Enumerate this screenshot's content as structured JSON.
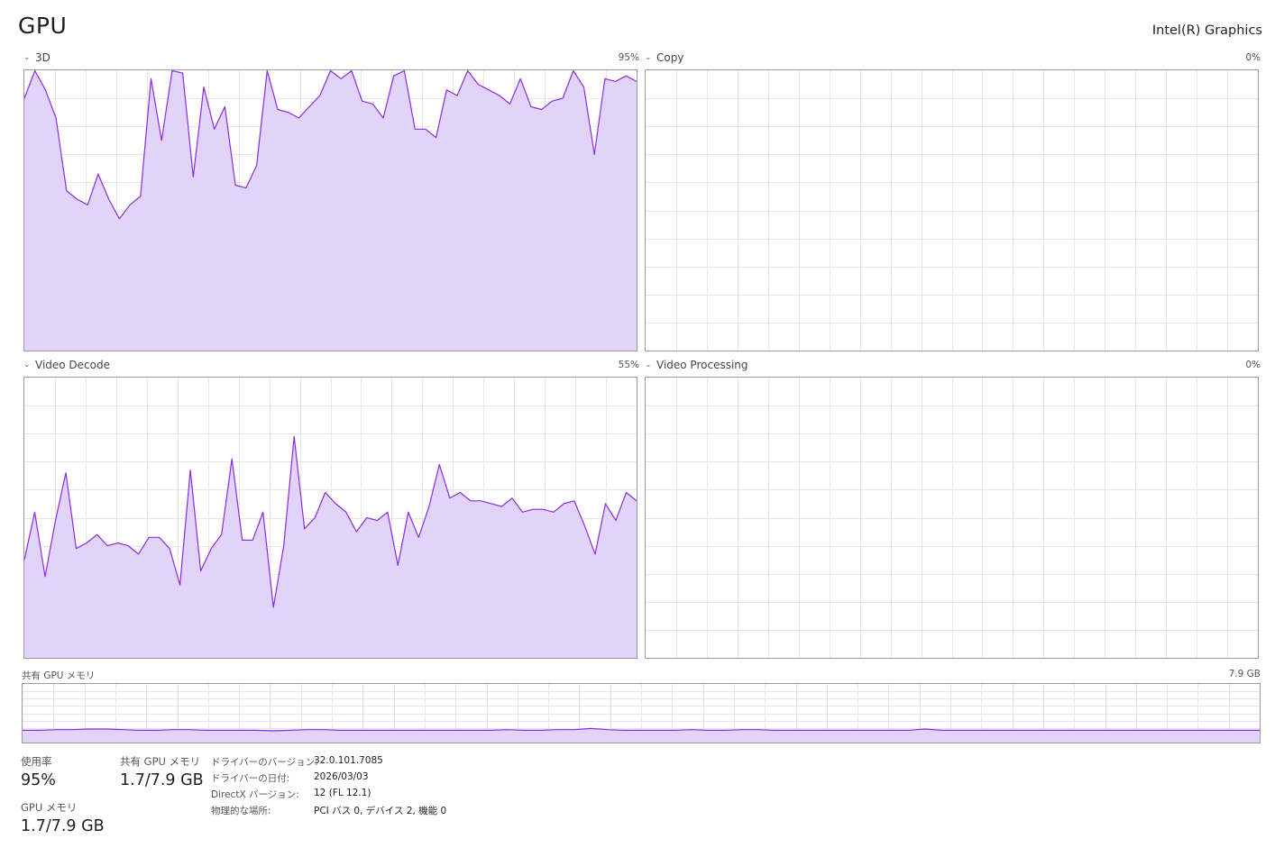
{
  "header": {
    "title": "GPU",
    "gpu_name": "Intel(R) Graphics"
  },
  "engines": [
    {
      "label": "3D",
      "percent": "95%",
      "series": [
        90,
        100,
        93,
        83,
        57,
        54,
        52,
        63,
        54,
        47,
        52,
        55,
        97,
        75,
        100,
        99,
        62,
        94,
        79,
        87,
        59,
        58,
        66,
        100,
        86,
        85,
        83,
        87,
        91,
        100,
        97,
        100,
        89,
        88,
        83,
        98,
        100,
        79,
        79,
        76,
        93,
        91,
        100,
        95,
        93,
        91,
        88,
        97,
        87,
        86,
        89,
        90,
        100,
        94,
        70,
        97,
        96,
        98,
        96
      ],
      "color": "#8a2be2"
    },
    {
      "label": "Copy",
      "percent": "0%",
      "series": [],
      "color": "#8a2be2"
    },
    {
      "label": "Video Decode",
      "percent": "55%",
      "series": [
        35,
        52,
        29,
        49,
        66,
        39,
        41,
        44,
        40,
        41,
        40,
        37,
        43,
        43,
        39,
        26,
        67,
        31,
        39,
        44,
        71,
        42,
        42,
        52,
        18,
        40,
        79,
        46,
        50,
        59,
        55,
        52,
        45,
        50,
        49,
        52,
        33,
        52,
        43,
        54,
        69,
        57,
        59,
        56,
        56,
        55,
        54,
        57,
        52,
        53,
        53,
        52,
        55,
        56,
        47,
        37,
        55,
        49,
        59,
        56
      ],
      "color": "#8a2be2"
    },
    {
      "label": "Video Processing",
      "percent": "0%",
      "series": [],
      "color": "#8a2be2"
    }
  ],
  "shared_memory": {
    "label": "共有 GPU メモリ",
    "max": "7.9 GB",
    "series": [
      21,
      21,
      22,
      22,
      23,
      23,
      22,
      21,
      21,
      22,
      22,
      21,
      21,
      21,
      21,
      20,
      21,
      22,
      22,
      21,
      21,
      21,
      21,
      21,
      21,
      21,
      21,
      21,
      21,
      22,
      21,
      21,
      22,
      22,
      24,
      22,
      21,
      21,
      21,
      21,
      22,
      21,
      21,
      22,
      22,
      21,
      21,
      21,
      21,
      21,
      21,
      21,
      21,
      21,
      23,
      21,
      21,
      21,
      21,
      21,
      21,
      21,
      21,
      21,
      21,
      21,
      21,
      21,
      21,
      21,
      21,
      21,
      21,
      21,
      21
    ]
  },
  "stats": {
    "utilization": {
      "label": "使用率",
      "value": "95%"
    },
    "shared_gpu_memory": {
      "label": "共有 GPU メモリ",
      "value": "1.7/7.9 GB"
    },
    "gpu_memory": {
      "label": "GPU メモリ",
      "value": "1.7/7.9 GB"
    }
  },
  "info": [
    {
      "key": "ドライバーのバージョン:",
      "value": "32.0.101.7085"
    },
    {
      "key": "ドライバーの日付:",
      "value": "2026/03/03"
    },
    {
      "key": "DirectX バージョン:",
      "value": "12 (FL 12.1)"
    },
    {
      "key": "物理的な場所:",
      "value": "PCI バス 0, デバイス 2, 機能 0"
    }
  ],
  "colors": {
    "line": "#8a2be2",
    "fill": "#e2d3fb",
    "grid": "#e6e6e6"
  }
}
